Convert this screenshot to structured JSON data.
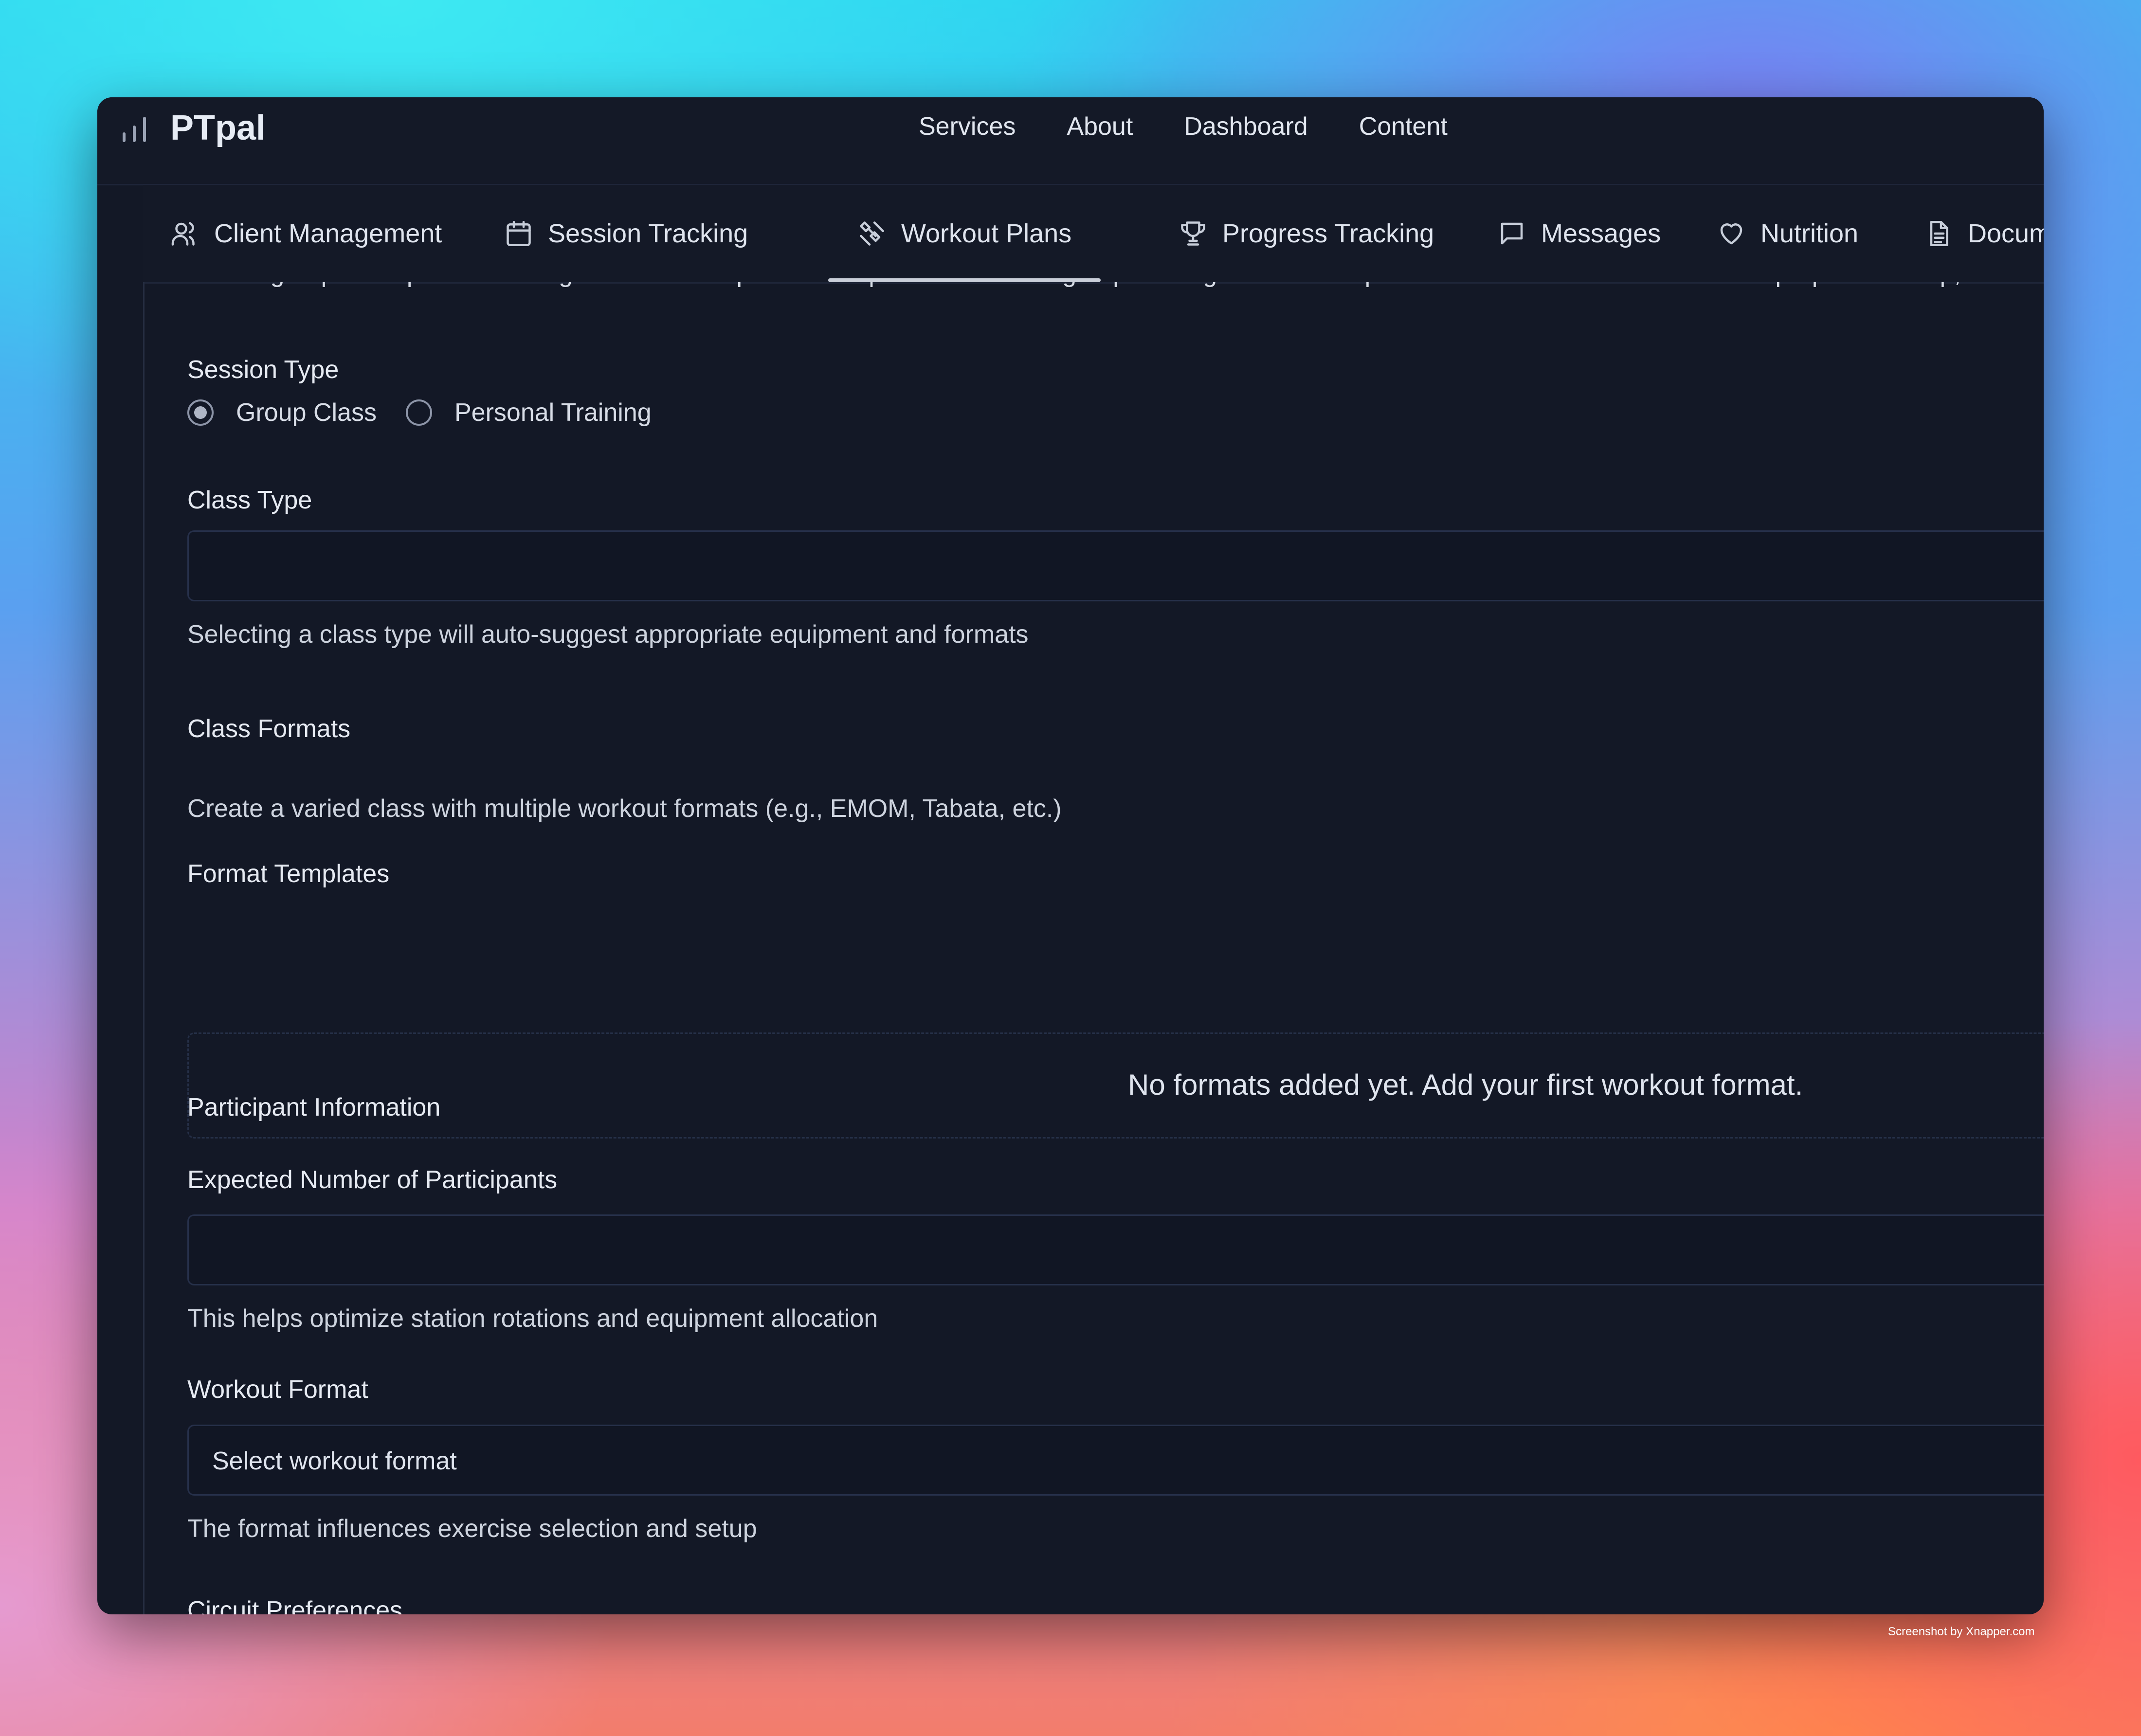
{
  "app": {
    "brand": "PTpal"
  },
  "top_nav": [
    "Services",
    "About",
    "Dashboard",
    "Content"
  ],
  "tabs": [
    {
      "label": "Client Management",
      "icon": "users-icon",
      "active": false
    },
    {
      "label": "Session Tracking",
      "icon": "calendar-icon",
      "active": false
    },
    {
      "label": "Workout Plans",
      "icon": "workout-icon",
      "active": true
    },
    {
      "label": "Progress Tracking",
      "icon": "trophy-icon",
      "active": false
    },
    {
      "label": "Messages",
      "icon": "message-icon",
      "active": false
    },
    {
      "label": "Nutrition",
      "icon": "heart-icon",
      "active": false
    },
    {
      "label": "Documents",
      "icon": "document-icon",
      "active": false
    }
  ],
  "form": {
    "intro": "Create group class plans following Coach Pete's proven blueprint for effective group training sessions.All plans follow a structured format with proper warm-up,",
    "session_type": {
      "label": "Session Type",
      "options": [
        "Group Class",
        "Personal Training"
      ],
      "selected": "Group Class"
    },
    "class_type": {
      "label": "Class Type",
      "value": "",
      "help": "Selecting a class type will auto-suggest appropriate equipment and formats"
    },
    "class_formats": {
      "label": "Class Formats",
      "description": "Create a varied class with multiple workout formats (e.g., EMOM, Tabata, etc.)",
      "templates_label": "Format Templates",
      "empty_message": "No formats added yet. Add your first workout format."
    },
    "participant_info": {
      "label": "Participant Information",
      "expected_label": "Expected Number of Participants",
      "value": "",
      "help": "This helps optimize station rotations and equipment allocation"
    },
    "workout_format": {
      "label": "Workout Format",
      "selected": "Select workout format",
      "help": "The format influences exercise selection and setup"
    },
    "circuit_preferences": {
      "label": "Circuit Preferences"
    }
  },
  "watermark": "Screenshot by Xnapper.com",
  "colors": {
    "window_bg": "#131826",
    "text": "#e1e6ef",
    "border": "#26304a"
  }
}
